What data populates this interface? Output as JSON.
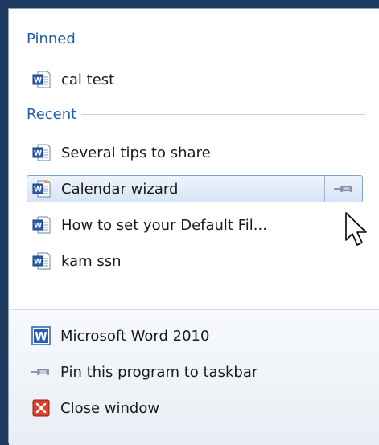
{
  "pinned": {
    "header": "Pinned",
    "items": [
      {
        "label": "cal test",
        "icon": "word-document-icon"
      }
    ]
  },
  "recent": {
    "header": "Recent",
    "items": [
      {
        "label": "Several tips to share",
        "icon": "word-document-icon"
      },
      {
        "label": "Calendar wizard",
        "icon": "word-document-icon",
        "highlighted": true
      },
      {
        "label": "How to set your Default Fil...",
        "icon": "word-document-icon"
      },
      {
        "label": "kam ssn",
        "icon": "word-document-icon"
      }
    ]
  },
  "tasks": [
    {
      "label": "Microsoft Word 2010",
      "icon": "word-app-icon"
    },
    {
      "label": "Pin this program to taskbar",
      "icon": "pin-icon"
    },
    {
      "label": "Close window",
      "icon": "close-window-icon"
    }
  ],
  "colors": {
    "accent": "#1e5eab",
    "highlight_border": "#7da2ce",
    "close_red": "#d9412b"
  }
}
